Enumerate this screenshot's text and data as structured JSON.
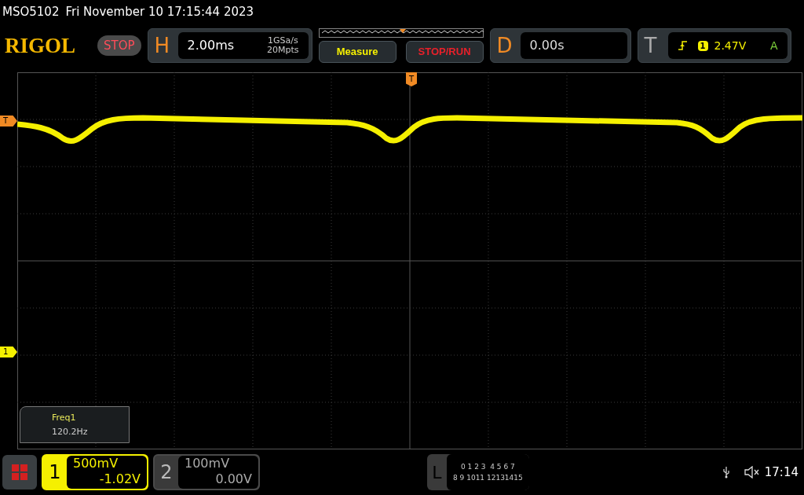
{
  "title_bar": {
    "model": "MSO5102",
    "datetime": "Fri November 10 17:15:44 2023"
  },
  "toolbar": {
    "logo": "RIGOL",
    "run_state": "STOP",
    "horizontal": {
      "letter": "H",
      "timebase": "2.00ms",
      "sample_rate": "1GSa/s",
      "memory_depth": "20Mpts"
    },
    "buttons": [
      {
        "label": "Measure",
        "kind": "measure"
      },
      {
        "label": "STOP/RUN",
        "kind": "run"
      }
    ],
    "delay": {
      "letter": "D",
      "value": "0.00s"
    },
    "trigger": {
      "letter": "T",
      "source": "1",
      "level": "2.47V",
      "mode": "A"
    }
  },
  "plot": {
    "trigger_position_marker": "T",
    "trigger_level_marker": "T",
    "channel_marker": "1",
    "measurement": {
      "name": "Freq1",
      "value": "120.2Hz"
    }
  },
  "bottom_bar": {
    "channels": [
      {
        "number": "1",
        "scale": "500mV",
        "offset": "-1.02V",
        "selected": true
      },
      {
        "number": "2",
        "scale": "100mV",
        "offset": "0.00V",
        "selected": false
      }
    ],
    "logic": {
      "letter": "L",
      "rows": [
        "0 1 2 3  4 5 6 7",
        "8 9 1011 12131415"
      ]
    },
    "time": "17:14"
  }
}
